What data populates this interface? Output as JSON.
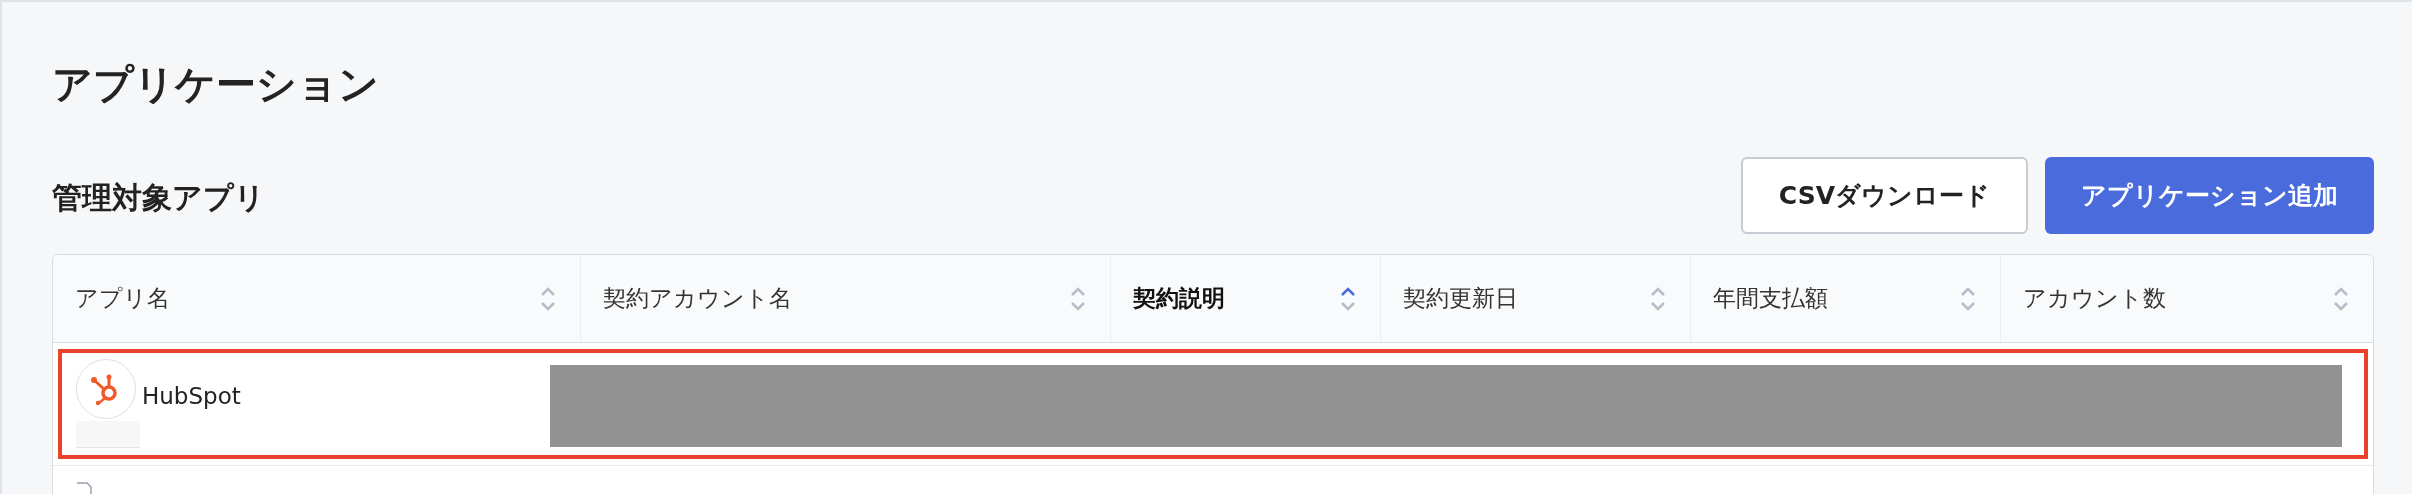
{
  "page": {
    "title": "アプリケーション"
  },
  "section": {
    "title": "管理対象アプリ"
  },
  "buttons": [
    {
      "label": "CSVダウンロード",
      "kind": "secondary"
    },
    {
      "label": "アプリケーション追加",
      "kind": "primary"
    }
  ],
  "table": {
    "columns": [
      {
        "label": "アプリ名",
        "sorted": false
      },
      {
        "label": "契約アカウント名",
        "sorted": false
      },
      {
        "label": "契約説明",
        "sorted": true
      },
      {
        "label": "契約更新日",
        "sorted": false
      },
      {
        "label": "年間支払額",
        "sorted": false
      },
      {
        "label": "アカウント数",
        "sorted": false
      }
    ],
    "rows": [
      {
        "kind": "app",
        "app_name": "HubSpot",
        "highlighted": true,
        "redacted": true
      },
      {
        "kind": "partial",
        "highlighted": false
      }
    ]
  }
}
